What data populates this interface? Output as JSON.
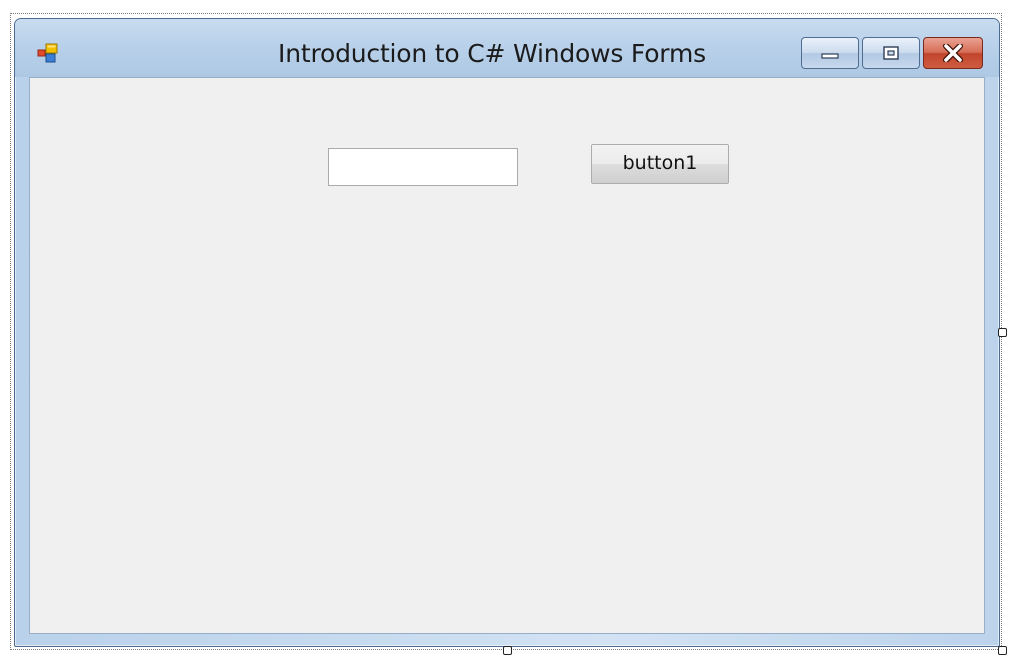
{
  "window": {
    "title": "Introduction to C# Windows Forms",
    "icon": "form-icon"
  },
  "caption_buttons": {
    "minimize_icon": "minimize-icon",
    "maximize_icon": "maximize-icon",
    "close_icon": "close-icon"
  },
  "form": {
    "textbox": {
      "value": "",
      "placeholder": ""
    },
    "button1": {
      "label": "button1"
    }
  },
  "colors": {
    "client_background": "#f0f0f0",
    "title_bar": "#b9d1ea",
    "close_button": "#c1452d"
  }
}
